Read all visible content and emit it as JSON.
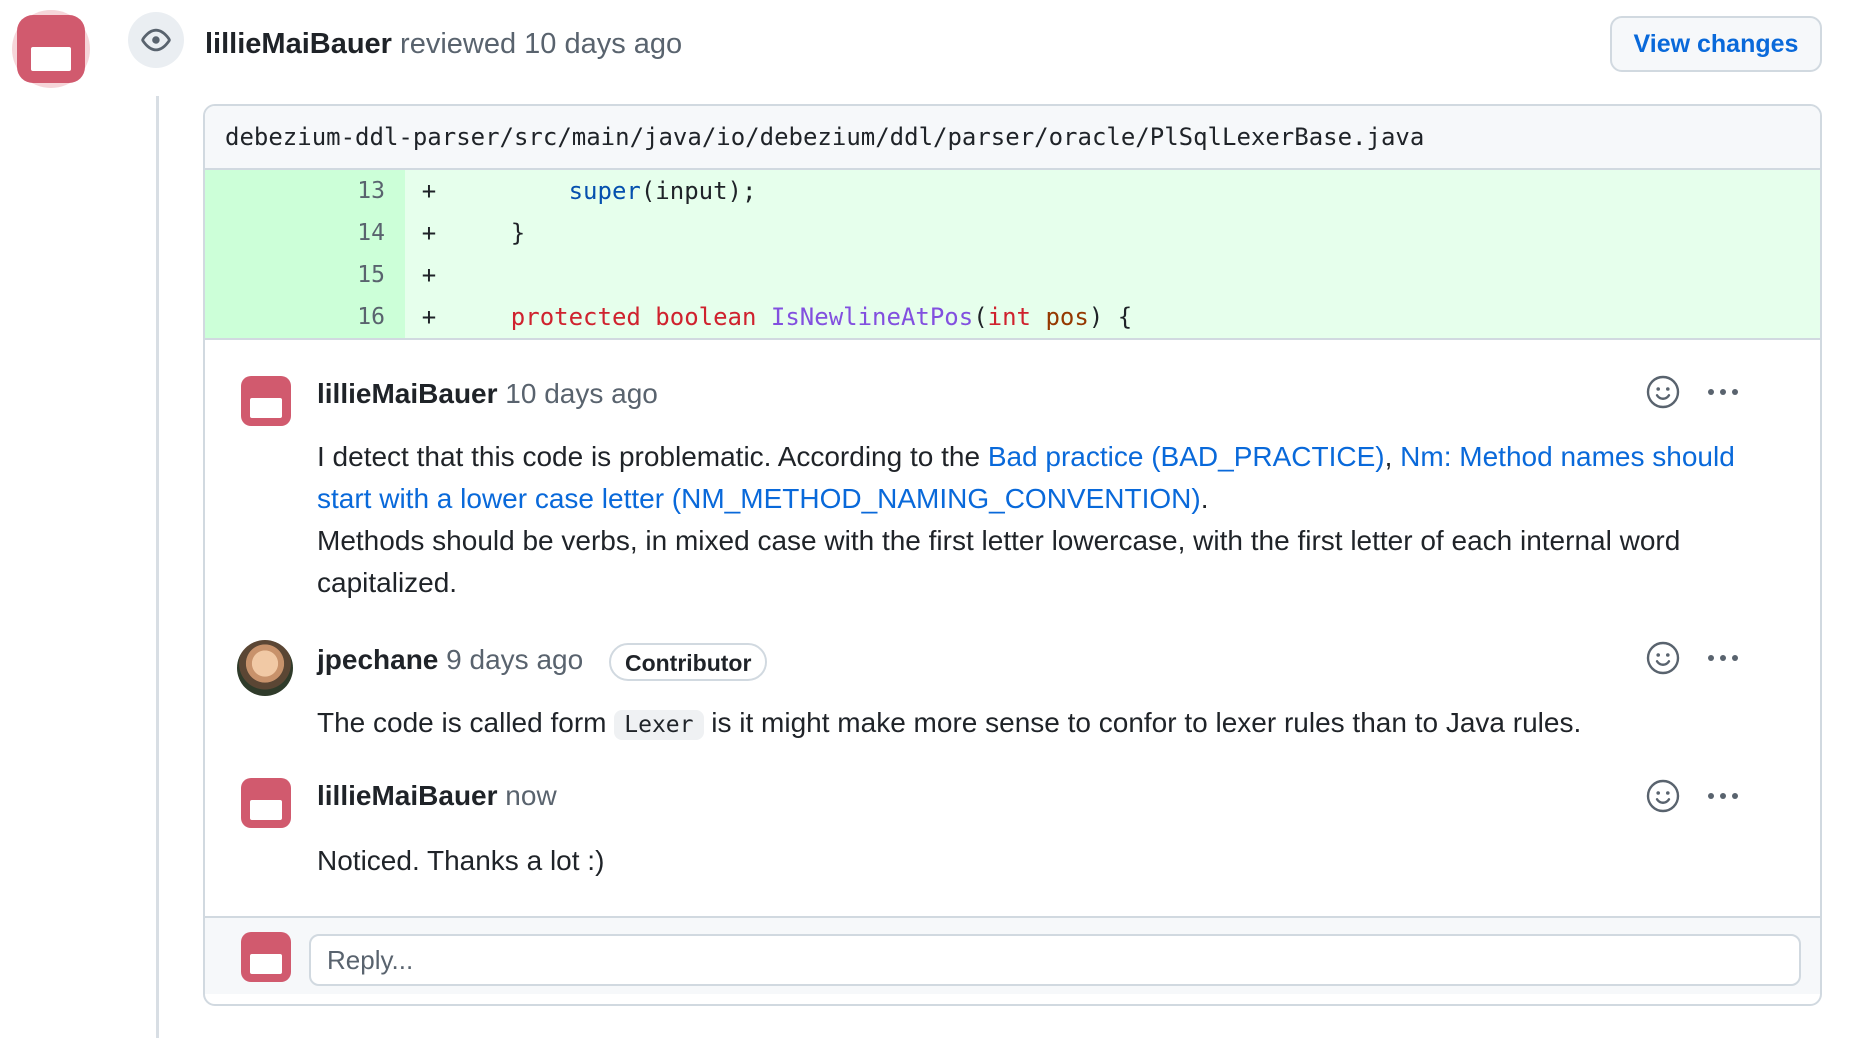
{
  "review": {
    "author": "lillieMaiBauer",
    "action": "reviewed 10 days ago",
    "view_changes_label": "View changes"
  },
  "file": {
    "path": "debezium-ddl-parser/src/main/java/io/debezium/ddl/parser/oracle/PlSqlLexerBase.java"
  },
  "diff_lines": [
    {
      "num": "13",
      "sign": "+"
    },
    {
      "num": "14",
      "sign": "+"
    },
    {
      "num": "15",
      "sign": "+"
    },
    {
      "num": "16",
      "sign": "+"
    }
  ],
  "code": {
    "line13_indent": "        ",
    "line13_super": "super",
    "line13_rest": "(input);",
    "line14": "    }",
    "line16_indent": "    ",
    "line16_protected": "protected",
    "line16_boolean": "boolean",
    "line16_name": "IsNewlineAtPos",
    "line16_open": "(",
    "line16_int": "int",
    "line16_pos": "pos",
    "line16_close": ") {"
  },
  "comments": [
    {
      "author": "lillieMaiBauer",
      "time": "10 days ago",
      "body_intro": "I detect that this code is problematic. According to the ",
      "link1": "Bad practice (BAD_PRACTICE)",
      "sep": ", ",
      "link2": "Nm: Method names should start with a lower case letter (NM_METHOD_NAMING_CONVENTION)",
      "period": ".",
      "body_line2": "Methods should be verbs, in mixed case with the first letter lowercase, with the first letter of each internal word capitalized."
    },
    {
      "author": "jpechane",
      "time": "9 days ago",
      "badge": "Contributor",
      "body_pre": "The code is called form ",
      "code": "Lexer",
      "body_post": " is it might make more sense to confor to lexer rules than to Java rules."
    },
    {
      "author": "lillieMaiBauer",
      "time": "now",
      "body": "Noticed. Thanks a lot :)"
    }
  ],
  "reply": {
    "placeholder": "Reply..."
  },
  "icons": {
    "eye": "eye-icon",
    "smiley": "smiley-icon",
    "kebab": "kebab-horizontal-icon"
  },
  "colors": {
    "link": "#0969da",
    "diff_added_bg": "#e6ffec",
    "diff_added_gutter": "#ccffd8",
    "avatar_red": "#d15a6e"
  }
}
